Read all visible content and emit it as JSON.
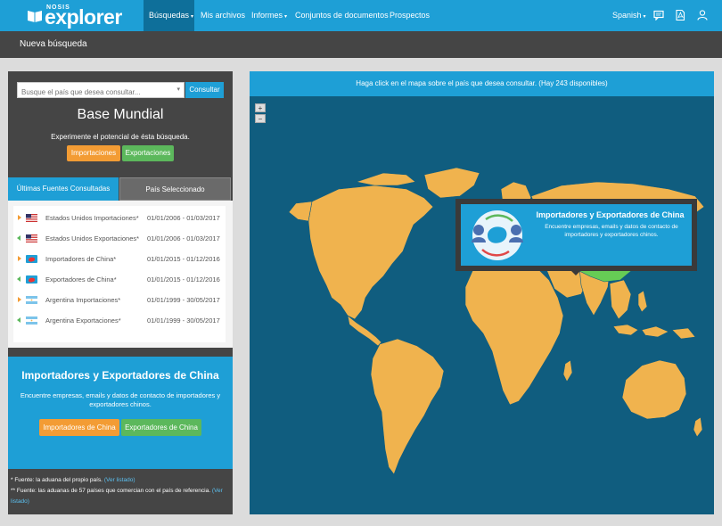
{
  "brand": {
    "small": "NOSIS",
    "big": "explorer"
  },
  "nav": {
    "items": [
      {
        "label": "Búsquedas",
        "caret": "▾"
      },
      {
        "label": "Mis archivos"
      },
      {
        "label": "Informes",
        "caret": "▾"
      },
      {
        "label": "Conjuntos de documentos"
      },
      {
        "label": "Prospectos"
      }
    ],
    "language": "Spanish",
    "language_caret": "▾",
    "icons": [
      "chat-icon",
      "pdf-icon",
      "user-icon"
    ]
  },
  "subheader": {
    "title": "Nueva búsqueda"
  },
  "search": {
    "placeholder": "Busque el país que desea consultar...",
    "chevron": "▾",
    "button": "Consultar"
  },
  "base": {
    "title": "Base Mundial",
    "subtitle": "Experimente el potencial de ésta búsqueda.",
    "btn_import": "Importaciones",
    "btn_export": "Exportaciones"
  },
  "tabs": [
    {
      "label": "Últimas Fuentes Consultadas",
      "active": true
    },
    {
      "label": "País Seleccionado",
      "active": false
    }
  ],
  "sources": [
    {
      "type": "import",
      "flag": "usa-flag",
      "name": "Estados Unidos Importaciones*",
      "dates": "01/01/2006 - 01/03/2017"
    },
    {
      "type": "export",
      "flag": "usa-flag",
      "name": "Estados Unidos Exportaciones*",
      "dates": "01/01/2006 - 01/03/2017"
    },
    {
      "type": "import",
      "flag": "china-map-flag",
      "name": "Importadores de China*",
      "dates": "01/01/2015 - 01/12/2016"
    },
    {
      "type": "export",
      "flag": "china-map-flag",
      "name": "Exportadores de China*",
      "dates": "01/01/2015 - 01/12/2016"
    },
    {
      "type": "import",
      "flag": "argentina-flag",
      "name": "Argentina Importaciones*",
      "dates": "01/01/1999 - 30/05/2017"
    },
    {
      "type": "export",
      "flag": "argentina-flag",
      "name": "Argentina Exportaciones*",
      "dates": "01/01/1999 - 30/05/2017"
    }
  ],
  "promo": {
    "title": "Importadores y Exportadores de China",
    "text": "Encuentre empresas, emails y datos de contacto de importadores y exportadores chinos.",
    "btn_importers": "Importadores de China",
    "btn_exporters": "Exportadores de China"
  },
  "footnotes": {
    "note1": "* Fuente: la aduana del propio país.",
    "note1_link": "(Ver listado)",
    "note2": "** Fuente: las aduanas de 57 países que comercian con el país de referencia.",
    "note2_link_a": "(Ver",
    "note2_link_b": "listado)"
  },
  "map": {
    "instruction": "Haga click en el mapa sobre el país que desea consultar. (Hay 243 disponibles)",
    "zoom_in": "+",
    "zoom_out": "−",
    "popup_title": "Importadores y Exportadores de China",
    "popup_text": "Encuentre empresas, emails y datos de contacto de importadores y exportadores chinos."
  },
  "colors": {
    "primary": "#1e9fd6",
    "dark": "#454545",
    "orange": "#f39c34",
    "green": "#5cb85c",
    "ocean": "#105d7f",
    "land": "#f0b34e",
    "selected": "#66cc55"
  }
}
